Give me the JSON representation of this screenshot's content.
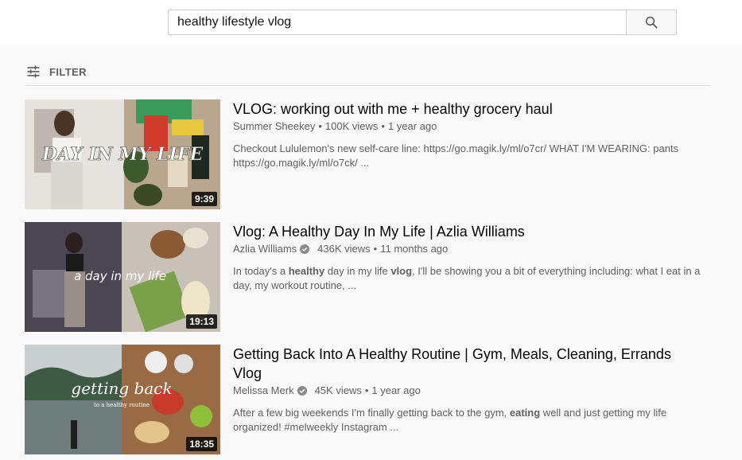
{
  "search": {
    "query": "healthy lifestyle vlog",
    "button_icon": "search-icon"
  },
  "filter": {
    "label": "FILTER",
    "icon": "sliders-icon"
  },
  "results": [
    {
      "title": "VLOG: working out with me + healthy grocery haul",
      "channel": "Summer Sheekey",
      "verified": false,
      "views": "100K views",
      "age": "1 year ago",
      "duration": "9:39",
      "thumb_overlay": "DAY IN MY LIFE",
      "desc_parts": [
        {
          "text": "Checkout Lululemon's new self-care line: https://go.magik.ly/ml/o7cr/ WHAT I'M WEARING: pants https://go.magik.ly/ml/o7ck/ ...",
          "bold": false
        }
      ]
    },
    {
      "title": "Vlog: A Healthy Day In My Life | Azlia Williams",
      "channel": "Azlia Williams",
      "verified": true,
      "views": "436K views",
      "age": "11 months ago",
      "duration": "19:13",
      "thumb_overlay": "a day in my life",
      "desc_parts": [
        {
          "text": "In today's a ",
          "bold": false
        },
        {
          "text": "healthy",
          "bold": true
        },
        {
          "text": " day in my life ",
          "bold": false
        },
        {
          "text": "vlog",
          "bold": true
        },
        {
          "text": ", I'll be showing you a bit of everything including: what I eat in a day, my workout routine, ...",
          "bold": false
        }
      ]
    },
    {
      "title": "Getting Back Into A Healthy Routine | Gym, Meals, Cleaning, Errands Vlog",
      "channel": "Melissa Merk",
      "verified": true,
      "views": "45K views",
      "age": "1 year ago",
      "duration": "18:35",
      "thumb_overlay": "getting back",
      "thumb_overlay_sub": "to a healthy routine",
      "desc_parts": [
        {
          "text": "After a few big weekends I'm finally getting back to the gym, ",
          "bold": false
        },
        {
          "text": "eating",
          "bold": true
        },
        {
          "text": " well and just getting my life organized! #melweekly Instagram ...",
          "bold": false
        }
      ]
    }
  ],
  "colors": {
    "background": "#f9f9f9",
    "meta_text": "#606060",
    "title_text": "#030303"
  }
}
